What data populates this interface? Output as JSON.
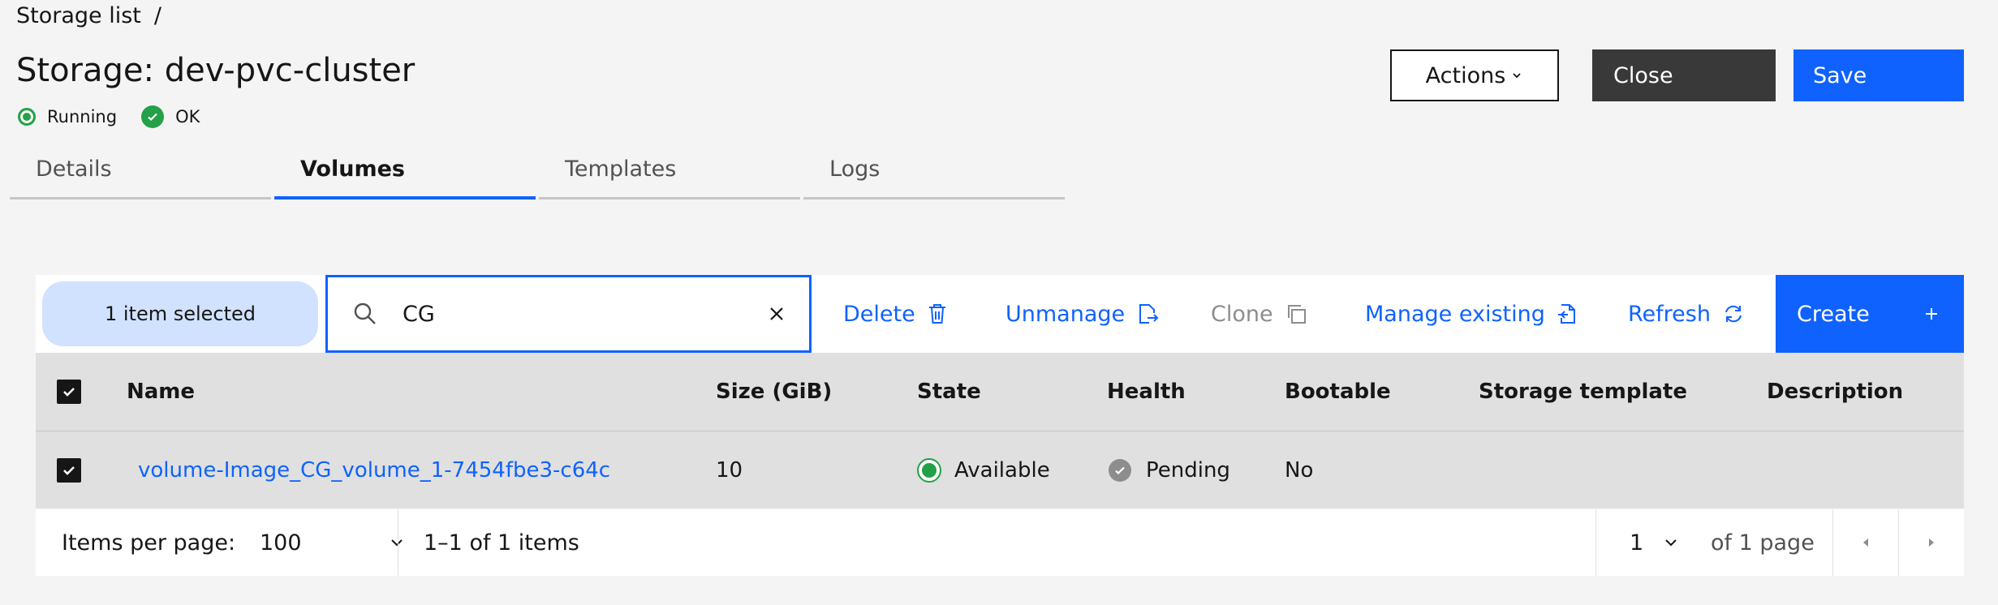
{
  "breadcrumb": {
    "item": "Storage list",
    "separator": "/"
  },
  "header": {
    "title": "Storage: dev-pvc-cluster",
    "status": [
      {
        "label": "Running",
        "icon": "running-status-icon"
      },
      {
        "label": "OK",
        "icon": "ok-check-icon"
      }
    ],
    "actions_label": "Actions",
    "close_label": "Close",
    "save_label": "Save"
  },
  "tabs": [
    {
      "label": "Details",
      "active": false
    },
    {
      "label": "Volumes",
      "active": true
    },
    {
      "label": "Templates",
      "active": false
    },
    {
      "label": "Logs",
      "active": false
    }
  ],
  "toolbar": {
    "selected_text": "1 item selected",
    "search_value": "CG",
    "delete_label": "Delete",
    "unmanage_label": "Unmanage",
    "clone_label": "Clone",
    "manage_existing_label": "Manage existing",
    "refresh_label": "Refresh",
    "create_label": "Create"
  },
  "table": {
    "columns": [
      "Name",
      "Size (GiB)",
      "State",
      "Health",
      "Bootable",
      "Storage template",
      "Description"
    ],
    "rows": [
      {
        "name": "volume-Image_CG_volume_1-7454fbe3-c64c",
        "size": "10",
        "state": "Available",
        "health": "Pending",
        "bootable": "No",
        "storage_template": "",
        "description": ""
      }
    ]
  },
  "pagination": {
    "items_per_page_label": "Items per page:",
    "items_per_page_value": "100",
    "range_text": "1–1 of 1 items",
    "page_value": "1",
    "of_pages_text": "of 1 page"
  },
  "colors": {
    "accent": "#0f62fe",
    "success": "#24a148",
    "selected_bg": "#d0e2ff",
    "table_bg": "#e0e0e0"
  }
}
